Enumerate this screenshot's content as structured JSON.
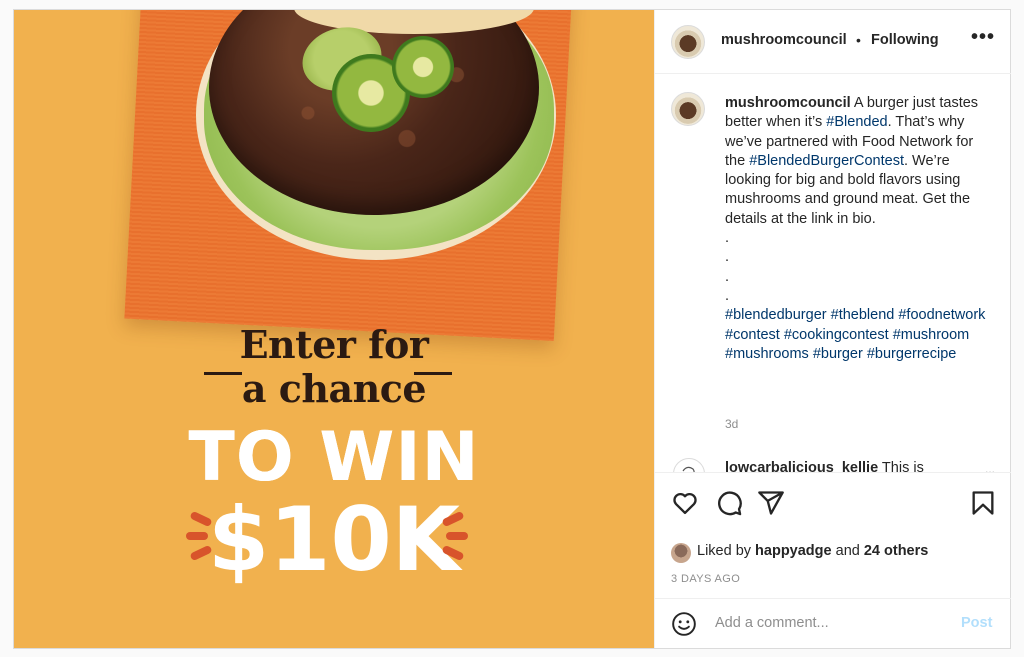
{
  "post": {
    "username": "mushroomcouncil",
    "separator": "•",
    "follow_state": "Following",
    "more_label": "•••",
    "media": {
      "headline_line1": "Enter for",
      "headline_line2": "a chance",
      "headline_line3": "TO WIN",
      "headline_line4": "$10K",
      "colors": {
        "background": "#f1b14e",
        "napkin": "#ec7a35",
        "text_dark": "#2b1a12"
      }
    },
    "caption": {
      "username": "mushroomcouncil",
      "text_1": "A burger just tastes better when it’s",
      "tag_1": "#Blended",
      "text_2": ". That’s why we’ve partnered with Food Network for the",
      "tag_2": "#BlendedBurgerContest",
      "text_3": ". We’re looking for big and bold flavors using mushrooms and ground meat. Get the details at the link in bio.",
      "dots": [
        ".",
        ".",
        ".",
        "."
      ],
      "hashtags": [
        "#blendedburger",
        "#theblend",
        "#foodnetwork",
        "#contest",
        "#cookingcontest",
        "#mushroom",
        "#mushrooms",
        "#burger",
        "#burgerrecipe"
      ],
      "time": "3d"
    },
    "comment": {
      "username": "lowcarbalicious_kellie",
      "text": "This is",
      "more": "..."
    },
    "likes": {
      "prefix": "Liked by",
      "user": "happyadge",
      "joiner": "and",
      "others": "24 others"
    },
    "posted_ago": "3 DAYS AGO",
    "add_comment": {
      "placeholder": "Add a comment...",
      "post_label": "Post"
    },
    "accent_colors": {
      "hashtag": "#00376b",
      "post_disabled": "#b2dffc"
    }
  }
}
